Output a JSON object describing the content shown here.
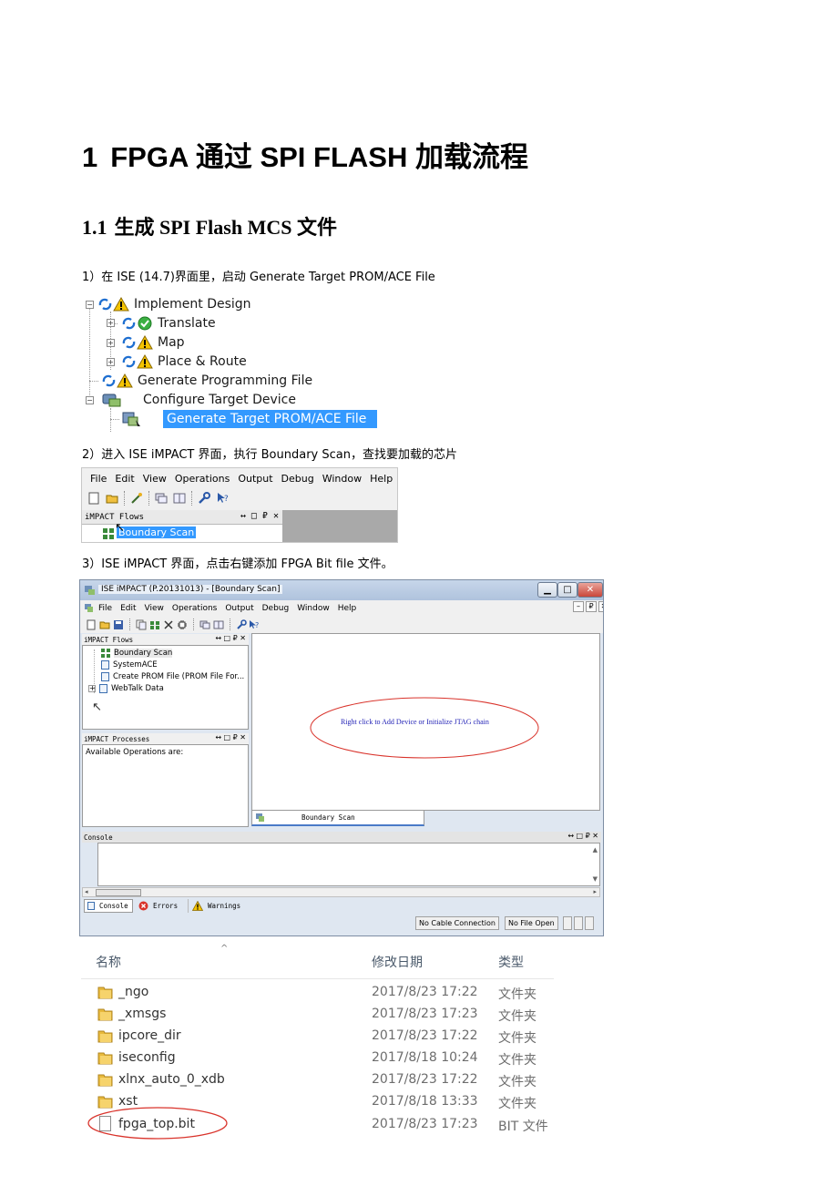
{
  "heading1": {
    "number": "1",
    "text": "FPGA 通过 SPI FLASH 加载流程"
  },
  "heading2": {
    "number": "1.1",
    "text": "生成 SPI Flash MCS 文件"
  },
  "steps": [
    "1）在 ISE (14.7)界面里，启动 Generate Target PROM/ACE File",
    "2）进入 ISE iMPACT 界面，执行 Boundary Scan，查找要加载的芯片",
    "3）ISE iMPACT 界面，点击右键添加 FPGA Bit file 文件。"
  ],
  "process_tree": {
    "items": [
      "Implement Design",
      "Translate",
      "Map",
      "Place & Route",
      "Generate Programming File",
      "Configure Target Device",
      "Generate Target PROM/ACE File"
    ]
  },
  "menu_shot": {
    "menus": [
      "File",
      "Edit",
      "View",
      "Operations",
      "Output",
      "Debug",
      "Window",
      "Help"
    ],
    "panel_title": "iMPACT Flows",
    "panel_controls": "↔ □ ₽ ✕",
    "selected_item": "Boundary Scan"
  },
  "impact_window": {
    "title": "ISE iMPACT (P.20131013) - [Boundary Scan]",
    "menus": [
      "File",
      "Edit",
      "View",
      "Operations",
      "Output",
      "Debug",
      "Window",
      "Help"
    ],
    "flows_title": "iMPACT Flows",
    "flows_items": [
      "Boundary Scan",
      "SystemACE",
      "Create PROM File (PROM File For...",
      "WebTalk Data"
    ],
    "processes_title": "iMPACT Processes",
    "processes_text": "Available Operations are:",
    "canvas_hint": "Right click to Add Device or Initialize JTAG chain",
    "canvas_tab": "Boundary Scan",
    "console_title": "Console",
    "console_tabs": [
      "Console",
      "Errors",
      "Warnings"
    ],
    "status_cable": "No Cable Connection",
    "status_file": "No File Open",
    "panel_controls": "↔ □ ₽ ✕"
  },
  "file_list": {
    "columns": [
      "名称",
      "修改日期",
      "类型"
    ],
    "rows": [
      {
        "name": "_ngo",
        "date": "2017/8/23 17:22",
        "type": "文件夹"
      },
      {
        "name": "_xmsgs",
        "date": "2017/8/23 17:23",
        "type": "文件夹"
      },
      {
        "name": "ipcore_dir",
        "date": "2017/8/23 17:22",
        "type": "文件夹"
      },
      {
        "name": "iseconfig",
        "date": "2017/8/18 10:24",
        "type": "文件夹"
      },
      {
        "name": "xlnx_auto_0_xdb",
        "date": "2017/8/23 17:22",
        "type": "文件夹"
      },
      {
        "name": "xst",
        "date": "2017/8/18 13:33",
        "type": "文件夹"
      },
      {
        "name": "fpga_top.bit",
        "date": "2017/8/23 17:23",
        "type": "BIT 文件"
      }
    ]
  },
  "colors": {
    "selection": "#3399ff",
    "annotation_circle": "#d9332b",
    "hint_text": "#1f1fb5"
  }
}
